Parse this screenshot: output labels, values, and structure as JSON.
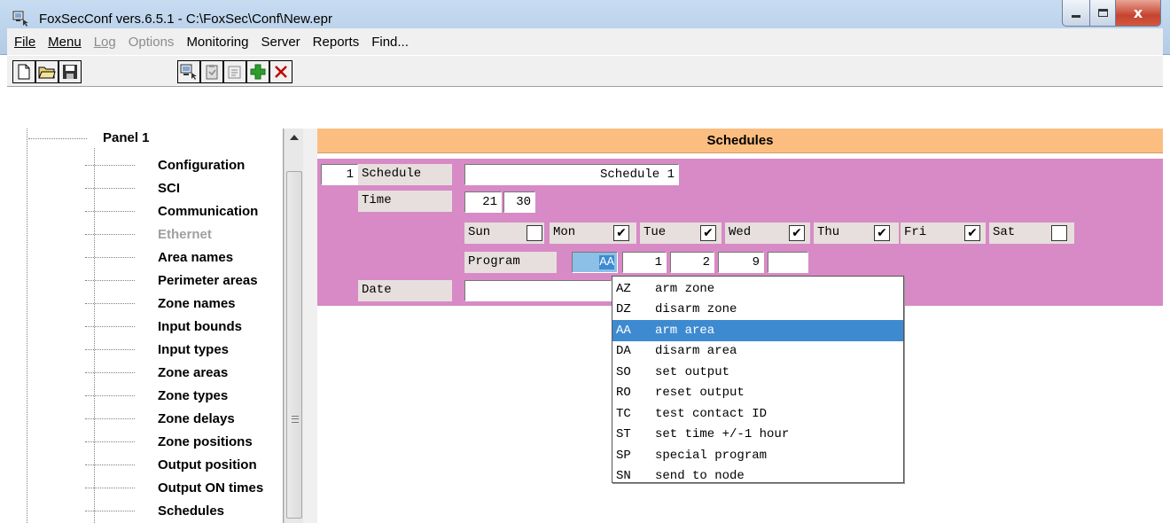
{
  "window": {
    "title": "FoxSecConf vers.6.5.1 - C:\\FoxSec\\Conf\\New.epr"
  },
  "menu": [
    {
      "label": "File",
      "disabled": false
    },
    {
      "label": "Menu",
      "disabled": false
    },
    {
      "label": "Log",
      "disabled": true
    },
    {
      "label": "Options",
      "disabled": true
    },
    {
      "label": "Monitoring",
      "disabled": false
    },
    {
      "label": "Server",
      "disabled": false
    },
    {
      "label": "Reports",
      "disabled": false
    },
    {
      "label": "Find...",
      "disabled": false
    }
  ],
  "toolbar": {
    "icons": [
      "new-document-icon",
      "open-folder-icon",
      "save-disk-icon",
      "connect-computer-icon",
      "clipboard-icon",
      "properties-icon",
      "add-plus-icon",
      "delete-x-icon"
    ],
    "colors": {
      "add": "#2d9c2d",
      "delete": "#c00000"
    }
  },
  "tree": {
    "root": "Panel 1",
    "items": [
      {
        "label": "Configuration",
        "disabled": false
      },
      {
        "label": "SCI",
        "disabled": false
      },
      {
        "label": "Communication",
        "disabled": false
      },
      {
        "label": "Ethernet",
        "disabled": true
      },
      {
        "label": "Area names",
        "disabled": false
      },
      {
        "label": "Perimeter areas",
        "disabled": false
      },
      {
        "label": "Zone names",
        "disabled": false
      },
      {
        "label": "Input bounds",
        "disabled": false
      },
      {
        "label": "Input types",
        "disabled": false
      },
      {
        "label": "Zone areas",
        "disabled": false
      },
      {
        "label": "Zone types",
        "disabled": false
      },
      {
        "label": "Zone delays",
        "disabled": false
      },
      {
        "label": "Zone positions",
        "disabled": false
      },
      {
        "label": "Output position",
        "disabled": false
      },
      {
        "label": "Output ON times",
        "disabled": false
      },
      {
        "label": "Schedules",
        "disabled": false
      }
    ]
  },
  "schedules": {
    "header": "Schedules",
    "index": "1",
    "schedule_label": "Schedule",
    "schedule_name": "Schedule 1",
    "time_label": "Time",
    "hour": "21",
    "minute": "30",
    "days": [
      {
        "label": "Sun",
        "checked": false
      },
      {
        "label": "Mon",
        "checked": true
      },
      {
        "label": "Tue",
        "checked": true
      },
      {
        "label": "Wed",
        "checked": true
      },
      {
        "label": "Thu",
        "checked": true
      },
      {
        "label": "Fri",
        "checked": true
      },
      {
        "label": "Sat",
        "checked": false
      }
    ],
    "program_label": "Program",
    "program_code": "AA",
    "param1": "1",
    "param2": "2",
    "param3": "9",
    "param4": "",
    "date_label": "Date",
    "date_value": ""
  },
  "dropdown": {
    "selected": "AA",
    "options": [
      {
        "code": "AZ",
        "text": "arm zone"
      },
      {
        "code": "DZ",
        "text": "disarm zone"
      },
      {
        "code": "AA",
        "text": "arm area"
      },
      {
        "code": "DA",
        "text": "disarm area"
      },
      {
        "code": "SO",
        "text": "set output"
      },
      {
        "code": "RO",
        "text": "reset output"
      },
      {
        "code": "TC",
        "text": "test contact ID"
      },
      {
        "code": "ST",
        "text": "set time +/-1 hour"
      },
      {
        "code": "SP",
        "text": "special program"
      },
      {
        "code": "SN",
        "text": "send to node"
      }
    ]
  },
  "colors": {
    "header_bg": "#fcbe80",
    "form_bg": "#d78ac5",
    "selection": "#3d8ad1"
  }
}
